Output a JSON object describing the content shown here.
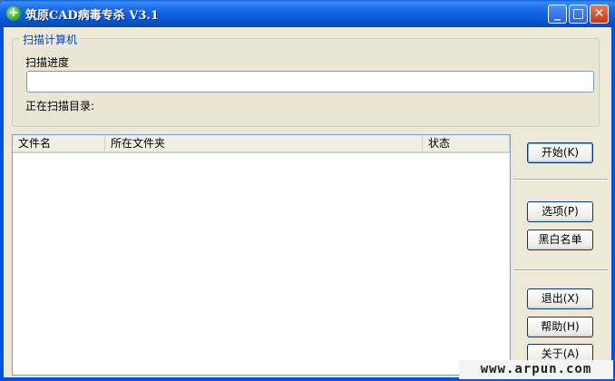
{
  "window": {
    "title": "筑原CAD病毒专杀  V3.1",
    "icon": "plus-icon",
    "controls": {
      "minimize": "_",
      "maximize": "□",
      "close": "✕"
    }
  },
  "scan_group": {
    "legend": "扫描计算机",
    "progress_label": "扫描进度",
    "progress": 0,
    "dir_label": "正在扫描目录:",
    "dir_value": ""
  },
  "file_list": {
    "columns": [
      "文件名",
      "所在文件夹",
      "状态"
    ],
    "rows": []
  },
  "buttons": {
    "start": "开始(K)",
    "options": "选项(P)",
    "blackwhite": "黑白名单",
    "exit": "退出(X)",
    "help": "帮助(H)",
    "about": "关于(A)"
  },
  "watermark": "www.arpun.com",
  "colors": {
    "title_bar": "#0a58d8",
    "client_bg": "#ece9d8",
    "legend": "#0046d5"
  }
}
